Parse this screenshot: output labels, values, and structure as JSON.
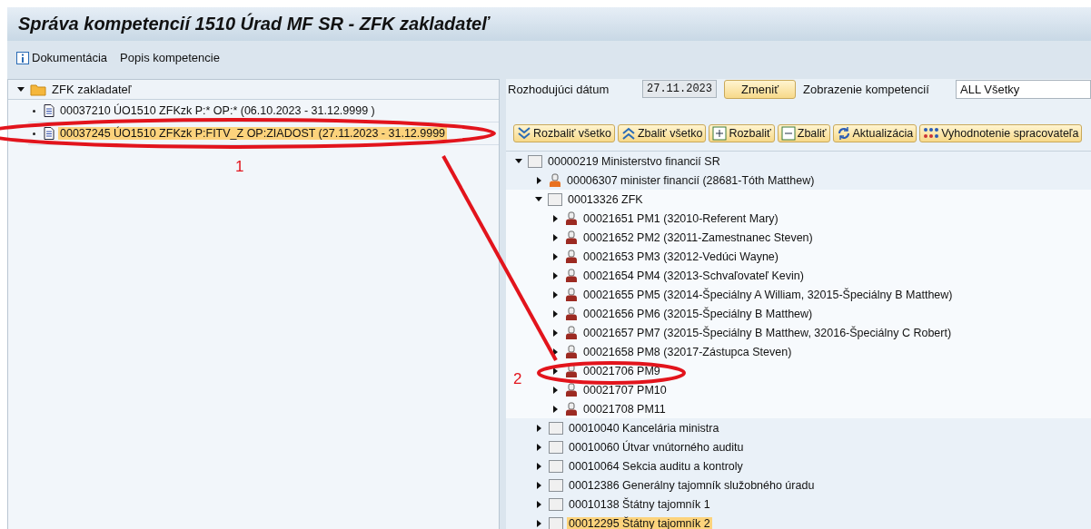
{
  "window": {
    "title": "Správa kompetencií 1510 Úrad MF SR - ZFK zakladateľ"
  },
  "toolbar": [
    {
      "kind": "info",
      "label": "Dokumentácia"
    },
    {
      "kind": "plain",
      "label": "Popis kompetencie"
    }
  ],
  "left_tree": {
    "nodes": [
      {
        "kind": "folder",
        "label": "ZFK zakladateľ",
        "expanded": true,
        "selected": false,
        "children": [
          {
            "kind": "document",
            "label": "00037210 ÚO1510 ZFKzk P:* OP:* (06.10.2023 - 31.12.9999 )",
            "selected": false
          },
          {
            "kind": "document",
            "label": "00037245 ÚO1510 ZFKzk P:FITV_Z OP:ZIADOST (27.11.2023 - 31.12.9999",
            "selected": true
          }
        ]
      }
    ]
  },
  "form": {
    "date_label": "Rozhodujúci dátum",
    "date_value": "27.11.2023",
    "change_button": "Zmeniť",
    "view_label": "Zobrazenie kompetencií",
    "view_value": "ALL Všetky"
  },
  "tree_toolbar": [
    {
      "kind": "expand_all",
      "label": "Rozbaliť všetko"
    },
    {
      "kind": "collapse_all",
      "label": "Zbaliť všetko"
    },
    {
      "kind": "expand",
      "label": "Rozbaliť"
    },
    {
      "kind": "collapse",
      "label": "Zbaliť"
    },
    {
      "kind": "refresh",
      "label": "Aktualizácia"
    },
    {
      "kind": "evaluate",
      "label": "Vyhodnotenie spracovateľa"
    }
  ],
  "right_tree": {
    "nodes": [
      {
        "kind": "org",
        "label": "00000219 Ministerstvo financií SR",
        "expanded": true,
        "selected": false,
        "children": [
          {
            "kind": "holder",
            "label": "00006307 minister financií (28681-Tóth Matthew)",
            "expanded": false,
            "selected": false
          },
          {
            "kind": "org",
            "label": "00013326 ZFK",
            "expanded": true,
            "selected": false,
            "children": [
              {
                "kind": "position",
                "label": "00021651 PM1 (32010-Referent Mary)",
                "expanded": false,
                "selected": false
              },
              {
                "kind": "position",
                "label": "00021652 PM2 (32011-Zamestnanec Steven)",
                "expanded": false,
                "selected": false
              },
              {
                "kind": "position",
                "label": "00021653 PM3 (32012-Vedúci Wayne)",
                "expanded": false,
                "selected": false
              },
              {
                "kind": "position",
                "label": "00021654 PM4 (32013-Schvaľovateľ Kevin)",
                "expanded": false,
                "selected": false
              },
              {
                "kind": "position",
                "label": "00021655 PM5 (32014-Špeciálny A William, 32015-Špeciálny B Matthew)",
                "expanded": false,
                "selected": false
              },
              {
                "kind": "position",
                "label": "00021656 PM6 (32015-Špeciálny B Matthew)",
                "expanded": false,
                "selected": false
              },
              {
                "kind": "position",
                "label": "00021657 PM7 (32015-Špeciálny B Matthew, 32016-Špeciálny C Robert)",
                "expanded": false,
                "selected": false
              },
              {
                "kind": "position",
                "label": "00021658 PM8 (32017-Zástupca Steven)",
                "expanded": false,
                "selected": false
              },
              {
                "kind": "position",
                "label": "00021706 PM9",
                "expanded": false,
                "selected": false
              },
              {
                "kind": "position",
                "label": "00021707 PM10",
                "expanded": false,
                "selected": false
              },
              {
                "kind": "position",
                "label": "00021708 PM11",
                "expanded": false,
                "selected": false
              }
            ]
          },
          {
            "kind": "org",
            "label": "00010040 Kancelária ministra",
            "expanded": false,
            "selected": false
          },
          {
            "kind": "org",
            "label": "00010060 Útvar vnútorného auditu",
            "expanded": false,
            "selected": false
          },
          {
            "kind": "org",
            "label": "00010064 Sekcia auditu a kontroly",
            "expanded": false,
            "selected": false
          },
          {
            "kind": "org",
            "label": "00012386 Generálny tajomník služobného úradu",
            "expanded": false,
            "selected": false
          },
          {
            "kind": "org",
            "label": "00010138 Štátny tajomník 1",
            "expanded": false,
            "selected": false
          },
          {
            "kind": "org",
            "label": "00012295 Štátny tajomník 2",
            "expanded": false,
            "selected": true
          }
        ]
      }
    ]
  },
  "annotations": [
    {
      "kind": "number",
      "text": "1"
    },
    {
      "kind": "number",
      "text": "2"
    }
  ]
}
